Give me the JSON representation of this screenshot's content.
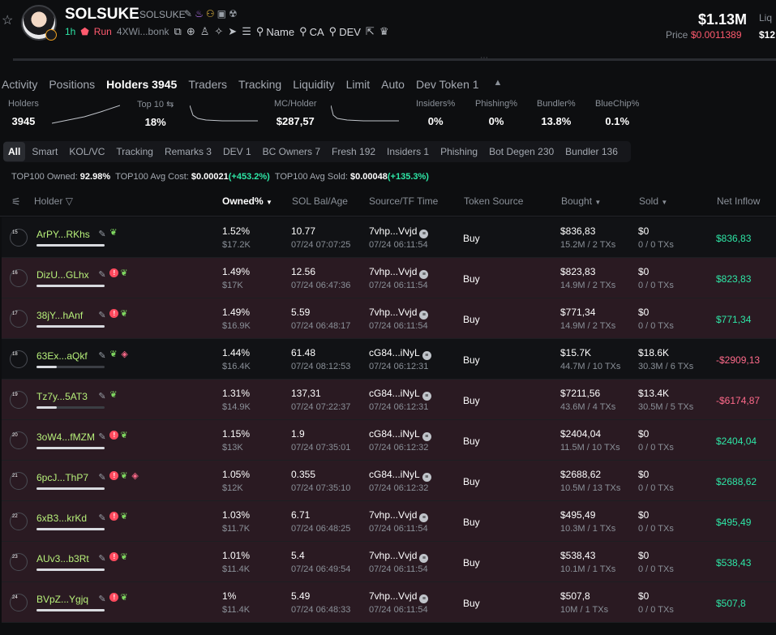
{
  "header": {
    "token_name": "SOLSUKE",
    "ticker": "SOLSUKE",
    "age": "1h",
    "run_label": "Run",
    "address": "4XWi...bonk",
    "search_name": "Name",
    "search_ca": "CA",
    "search_dev": "DEV",
    "market_cap": "$1.13M",
    "price_label": "Price",
    "price": "$0.0011389",
    "liq_label": "Liq",
    "liq_value": "$12"
  },
  "tabs": [
    "Activity",
    "Positions",
    "Holders 3945",
    "Traders",
    "Tracking",
    "Liquidity",
    "Limit",
    "Auto",
    "Dev Token 1"
  ],
  "active_tab": "Holders 3945",
  "stats": {
    "holders_label": "Holders",
    "holders_value": "3945",
    "top10_label": "Top 10",
    "top10_value": "18%",
    "mc_holder_label": "MC/Holder",
    "mc_holder_value": "$287,57",
    "insiders_label": "Insiders%",
    "insiders_value": "0%",
    "phishing_label": "Phishing%",
    "phishing_value": "0%",
    "bundler_label": "Bundler%",
    "bundler_value": "13.8%",
    "bluechip_label": "BlueChip%",
    "bluechip_value": "0.1%"
  },
  "chips": [
    "All",
    "Smart",
    "KOL/VC",
    "Tracking",
    "Remarks 3",
    "DEV 1",
    "BC Owners 7",
    "Fresh 192",
    "Insiders 1",
    "Phishing",
    "Bot Degen 230",
    "Bundler 136"
  ],
  "summary": {
    "owned_label": "TOP100 Owned:",
    "owned_value": "92.98%",
    "cost_label": "TOP100 Avg Cost:",
    "cost_value": "$0.00021",
    "cost_change": "(+453.2%)",
    "sold_label": "TOP100 Avg Sold:",
    "sold_value": "$0.00048",
    "sold_change": "(+135.3%)"
  },
  "columns": {
    "holder": "Holder",
    "owned": "Owned%",
    "sol_bal": "SOL Bal/Age",
    "source": "Source/TF Time",
    "token_source": "Token Source",
    "bought": "Bought",
    "sold": "Sold",
    "net_inflow": "Net Inflow"
  },
  "rows": [
    {
      "rank": "15",
      "addr": "ArPY...RKhs",
      "owned": "1.52%",
      "owned_usd": "$17.2K",
      "sol": "10.77",
      "sol_time": "07/24 07:07:25",
      "src": "7vhp...Vvjd",
      "src_time": "07/24 06:11:54",
      "token_src": "Buy",
      "bought": "$836,83",
      "bought_sub": "15.2M / 2 TXs",
      "sold": "$0",
      "sold_sub": "0 / 0 TXs",
      "net": "$836,83",
      "net_sign": "pos",
      "bg": "dark",
      "warn": false,
      "layers": false,
      "bar": 1.0
    },
    {
      "rank": "16",
      "addr": "DizU...GLhx",
      "owned": "1.49%",
      "owned_usd": "$17K",
      "sol": "12.56",
      "sol_time": "07/24 06:47:36",
      "src": "7vhp...Vvjd",
      "src_time": "07/24 06:11:54",
      "token_src": "Buy",
      "bought": "$823,83",
      "bought_sub": "14.9M / 2 TXs",
      "sold": "$0",
      "sold_sub": "0 / 0 TXs",
      "net": "$823,83",
      "net_sign": "pos",
      "bg": "red",
      "warn": true,
      "layers": false,
      "bar": 1.0
    },
    {
      "rank": "17",
      "addr": "38jY...hAnf",
      "owned": "1.49%",
      "owned_usd": "$16.9K",
      "sol": "5.59",
      "sol_time": "07/24 06:48:17",
      "src": "7vhp...Vvjd",
      "src_time": "07/24 06:11:54",
      "token_src": "Buy",
      "bought": "$771,34",
      "bought_sub": "14.9M / 2 TXs",
      "sold": "$0",
      "sold_sub": "0 / 0 TXs",
      "net": "$771,34",
      "net_sign": "pos",
      "bg": "red",
      "warn": true,
      "layers": false,
      "bar": 1.0
    },
    {
      "rank": "18",
      "addr": "63Ex...aQkf",
      "owned": "1.44%",
      "owned_usd": "$16.4K",
      "sol": "61.48",
      "sol_time": "07/24 08:12:53",
      "src": "cG84...iNyL",
      "src_time": "07/24 06:12:31",
      "token_src": "Buy",
      "bought": "$15.7K",
      "bought_sub": "44.7M / 10 TXs",
      "sold": "$18.6K",
      "sold_sub": "30.3M / 6 TXs",
      "net": "-$2909,13",
      "net_sign": "neg",
      "bg": "dark",
      "warn": false,
      "layers": true,
      "bar": 0.3
    },
    {
      "rank": "19",
      "addr": "Tz7y...5AT3",
      "owned": "1.31%",
      "owned_usd": "$14.9K",
      "sol": "137,31",
      "sol_time": "07/24 07:22:37",
      "src": "cG84...iNyL",
      "src_time": "07/24 06:12:31",
      "token_src": "Buy",
      "bought": "$7211,56",
      "bought_sub": "43.6M / 4 TXs",
      "sold": "$13.4K",
      "sold_sub": "30.5M / 5 TXs",
      "net": "-$6174,87",
      "net_sign": "neg",
      "bg": "red",
      "warn": false,
      "layers": false,
      "bar": 0.3
    },
    {
      "rank": "20",
      "addr": "3oW4...fMZM",
      "owned": "1.15%",
      "owned_usd": "$13K",
      "sol": "1.9",
      "sol_time": "07/24 07:35:01",
      "src": "cG84...iNyL",
      "src_time": "07/24 06:12:32",
      "token_src": "Buy",
      "bought": "$2404,04",
      "bought_sub": "11.5M / 10 TXs",
      "sold": "$0",
      "sold_sub": "0 / 0 TXs",
      "net": "$2404,04",
      "net_sign": "pos",
      "bg": "red",
      "warn": true,
      "layers": false,
      "bar": 1.0
    },
    {
      "rank": "21",
      "addr": "6pcJ...ThP7",
      "owned": "1.05%",
      "owned_usd": "$12K",
      "sol": "0.355",
      "sol_time": "07/24 07:35:10",
      "src": "cG84...iNyL",
      "src_time": "07/24 06:12:32",
      "token_src": "Buy",
      "bought": "$2688,62",
      "bought_sub": "10.5M / 13 TXs",
      "sold": "$0",
      "sold_sub": "0 / 0 TXs",
      "net": "$2688,62",
      "net_sign": "pos",
      "bg": "red",
      "warn": true,
      "layers": true,
      "bar": 1.0
    },
    {
      "rank": "22",
      "addr": "6xB3...krKd",
      "owned": "1.03%",
      "owned_usd": "$11.7K",
      "sol": "6.71",
      "sol_time": "07/24 06:48:25",
      "src": "7vhp...Vvjd",
      "src_time": "07/24 06:11:54",
      "token_src": "Buy",
      "bought": "$495,49",
      "bought_sub": "10.3M / 1 TXs",
      "sold": "$0",
      "sold_sub": "0 / 0 TXs",
      "net": "$495,49",
      "net_sign": "pos",
      "bg": "red",
      "warn": true,
      "layers": false,
      "bar": 1.0
    },
    {
      "rank": "23",
      "addr": "AUv3...b3Rt",
      "owned": "1.01%",
      "owned_usd": "$11.4K",
      "sol": "5.4",
      "sol_time": "07/24 06:49:54",
      "src": "7vhp...Vvjd",
      "src_time": "07/24 06:11:54",
      "token_src": "Buy",
      "bought": "$538,43",
      "bought_sub": "10.1M / 1 TXs",
      "sold": "$0",
      "sold_sub": "0 / 0 TXs",
      "net": "$538,43",
      "net_sign": "pos",
      "bg": "red",
      "warn": true,
      "layers": false,
      "bar": 1.0
    },
    {
      "rank": "24",
      "addr": "BVpZ...Ygjq",
      "owned": "1%",
      "owned_usd": "$11.4K",
      "sol": "5.49",
      "sol_time": "07/24 06:48:33",
      "src": "7vhp...Vvjd",
      "src_time": "07/24 06:11:54",
      "token_src": "Buy",
      "bought": "$507,8",
      "bought_sub": "10M / 1 TXs",
      "sold": "$0",
      "sold_sub": "0 / 0 TXs",
      "net": "$507,8",
      "net_sign": "pos",
      "bg": "red",
      "warn": true,
      "layers": false,
      "bar": 1.0
    }
  ]
}
